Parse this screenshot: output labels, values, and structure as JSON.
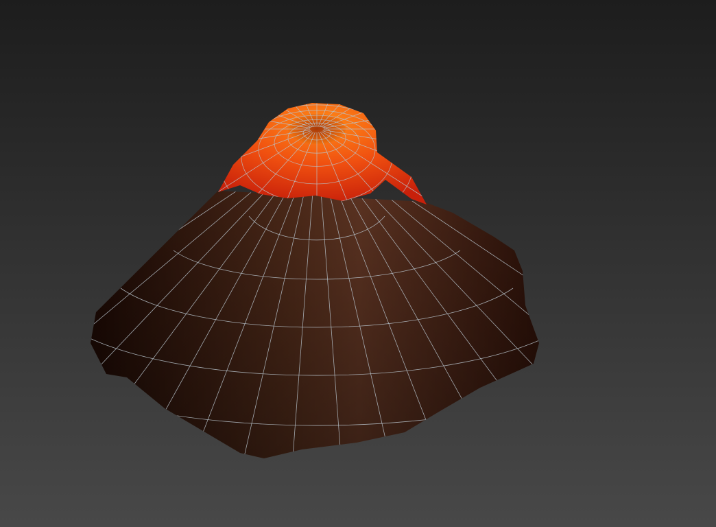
{
  "viewport": {
    "background_top": "#1d1d1d",
    "background_bottom": "#484848",
    "wire_color": "#b8c4cc"
  },
  "model": {
    "cone_light": "#5a3221",
    "cone_dark": "#1a0904",
    "lava_light": "#ff7a10",
    "lava_dark": "#d8240c",
    "crater_inner": "#e05a0a"
  }
}
